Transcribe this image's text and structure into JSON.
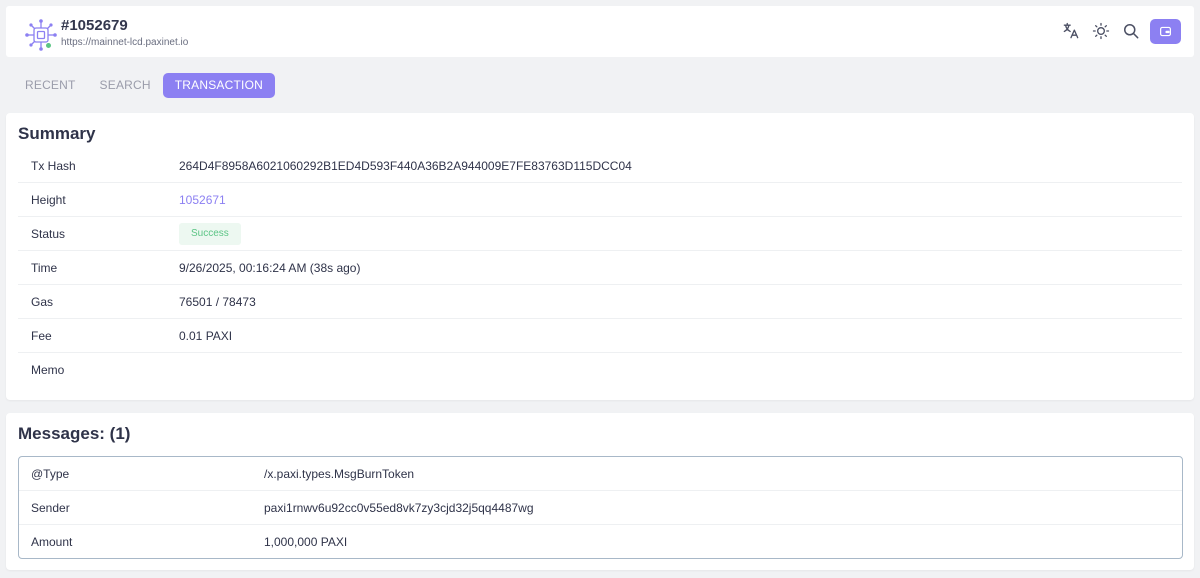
{
  "header": {
    "title": "#1052679",
    "url": "https://mainnet-lcd.paxinet.io",
    "icons": [
      "translate-icon",
      "theme-sun-icon",
      "search-icon",
      "wallet-icon"
    ]
  },
  "tabs": [
    {
      "label": "RECENT",
      "active": false
    },
    {
      "label": "SEARCH",
      "active": false
    },
    {
      "label": "TRANSACTION",
      "active": true
    }
  ],
  "summary": {
    "title": "Summary",
    "rows": [
      {
        "key": "Tx Hash",
        "value": "264D4F8958A6021060292B1ED4D593F440A36B2A944009E7FE83763D115DCC04"
      },
      {
        "key": "Height",
        "value": "1052671"
      },
      {
        "key": "Status",
        "value": "Success"
      },
      {
        "key": "Time",
        "value": "9/26/2025, 00:16:24 AM (38s ago)"
      },
      {
        "key": "Gas",
        "value": "76501 / 78473"
      },
      {
        "key": "Fee",
        "value": "0.01 PAXI"
      },
      {
        "key": "Memo",
        "value": ""
      }
    ]
  },
  "messages": {
    "title": "Messages: (1)",
    "rows": [
      {
        "key": "@Type",
        "value": "/x.paxi.types.MsgBurnToken"
      },
      {
        "key": "Sender",
        "value": "paxi1rnwv6u92cc0v55ed8vk7zy3cjd32j5qq4487wg"
      },
      {
        "key": "Amount",
        "value": "1,000,000 PAXI"
      }
    ]
  },
  "colors": {
    "accent": "#8c80f2",
    "success": "#5cc585",
    "success_bg": "#edf8f1",
    "background": "#f1f2f4"
  }
}
